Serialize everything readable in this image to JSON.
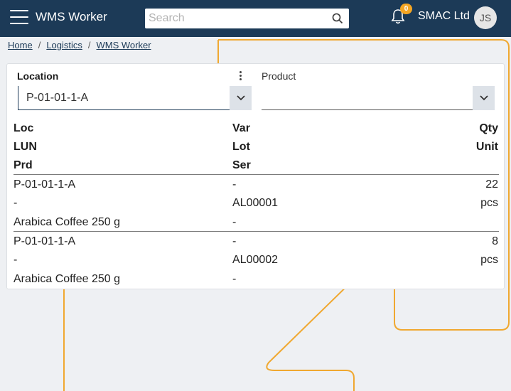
{
  "header": {
    "app_title": "WMS Worker",
    "search_placeholder": "Search",
    "notification_count": "0",
    "company": "SMAC Ltd",
    "avatar_initials": "JS"
  },
  "breadcrumb": [
    "Home",
    "Logistics",
    "WMS Worker"
  ],
  "filters": {
    "location_label": "Location",
    "location_value": "P-01-01-1-A",
    "product_label": "Product",
    "product_value": ""
  },
  "table": {
    "headers": {
      "col1": [
        "Loc",
        "LUN",
        "Prd"
      ],
      "col2": [
        "Var",
        "Lot",
        "Ser"
      ],
      "col3": [
        "Qty",
        "Unit"
      ]
    },
    "rows": [
      {
        "loc": "P-01-01-1-A",
        "lun": "-",
        "prd": "Arabica Coffee 250 g",
        "var": "-",
        "lot": "AL00001",
        "ser": "-",
        "qty": "22",
        "unit": "pcs"
      },
      {
        "loc": "P-01-01-1-A",
        "lun": "-",
        "prd": "Arabica Coffee 250 g",
        "var": "-",
        "lot": "AL00002",
        "ser": "-",
        "qty": "8",
        "unit": "pcs"
      }
    ]
  },
  "colors": {
    "topbar": "#1c3a57",
    "accent": "#f5a623",
    "background": "#eef0f3"
  }
}
